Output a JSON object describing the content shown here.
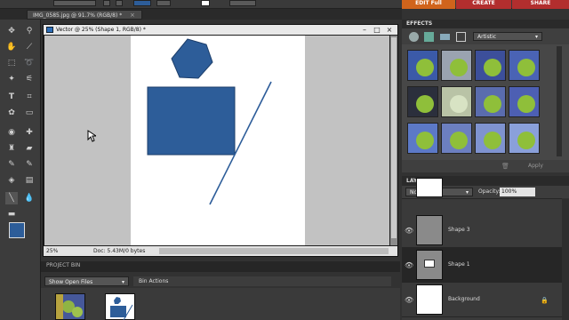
{
  "top_bar": {
    "edit_full": "EDIT Full",
    "create": "CREATE",
    "share": "SHARE"
  },
  "tabs": {
    "active_tab": "IMG_0585.jpg @ 91.7% (RGB/8) *",
    "close_glyph": "×"
  },
  "toolbox": {
    "tools": [
      "zoom",
      "hand",
      "move",
      "eyedropper",
      "marquee",
      "lasso",
      "magic-wand",
      "selection-brush",
      "type",
      "crop",
      "cookie-cutter",
      "straighten",
      "red-eye",
      "healing",
      "clone-stamp",
      "eraser",
      "brush",
      "smart-brush",
      "paint-bucket",
      "gradient",
      "shape",
      "blur",
      "line",
      "sponge"
    ],
    "foreground_color": "#2d5d99",
    "background_color": "#ffffff"
  },
  "document": {
    "title": "Vector @ 25% (Shape 1, RGB/8) *",
    "zoom": "25%",
    "doc_size": "Doc: 5.43M/0 bytes",
    "shape_color": "#2d5d99"
  },
  "project_bin": {
    "header": "PROJECT BIN",
    "dropdown": "Show Open Files",
    "actions": "Bin Actions"
  },
  "effects": {
    "header": "EFFECTS",
    "filter_select": "Artistic",
    "apply_label": "Apply"
  },
  "layers": {
    "header": "LAYERS",
    "blend_mode": "Normal",
    "opacity_label": "Opacity:",
    "opacity_value": "100%",
    "items": [
      {
        "name": "Shape 3"
      },
      {
        "name": "Shape 1"
      },
      {
        "name": "Background"
      }
    ]
  }
}
